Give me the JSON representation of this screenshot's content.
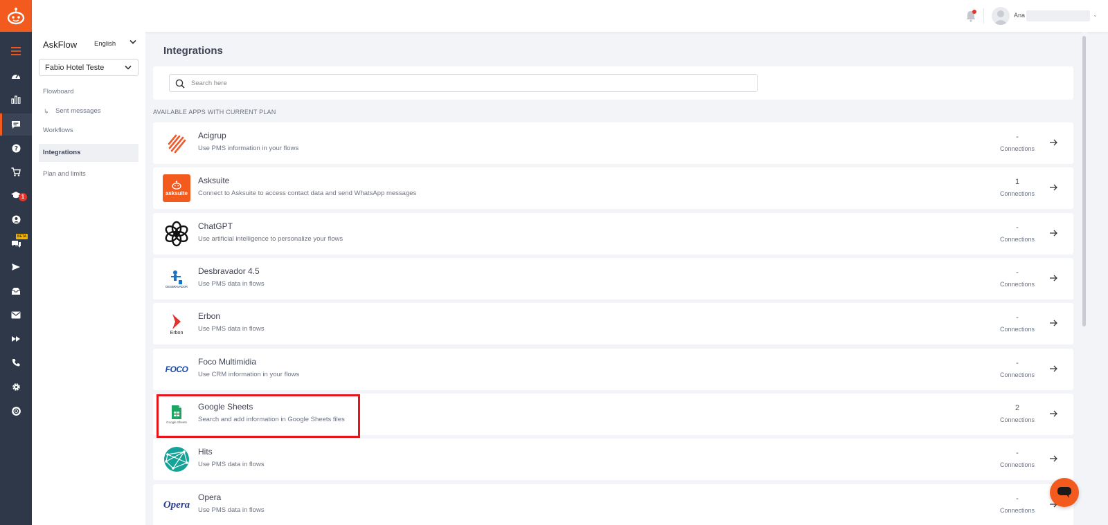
{
  "brand": {
    "accent": "#f35a1e",
    "rail_bg": "#2f3849",
    "highlight": "#e8141c"
  },
  "rail": {
    "items": [
      {
        "icon": "menu-icon"
      },
      {
        "icon": "dashboard-icon"
      },
      {
        "icon": "bar-chart-icon"
      },
      {
        "icon": "chat-flow-icon",
        "active": true
      },
      {
        "icon": "help-icon"
      },
      {
        "icon": "cart-icon"
      },
      {
        "icon": "graduation-cap-icon",
        "badge": "1"
      },
      {
        "icon": "user-circle-icon"
      },
      {
        "icon": "chat-bubbles-icon",
        "badge_beta": "BETA"
      },
      {
        "icon": "send-icon"
      },
      {
        "icon": "inbox-icon"
      },
      {
        "icon": "mail-icon"
      },
      {
        "icon": "fast-forward-icon"
      },
      {
        "icon": "phone-icon"
      },
      {
        "icon": "gear-icon"
      },
      {
        "icon": "lifebuoy-icon"
      }
    ]
  },
  "topbar": {
    "user_name": "Ana"
  },
  "sidebar": {
    "title": "AskFlow",
    "language": "English",
    "hotel": "Fabio Hotel Teste",
    "links": {
      "flowboard": "Flowboard",
      "sent_messages": "Sent messages",
      "workflows": "Workflows",
      "integrations": "Integrations",
      "plan": "Plan and limits"
    }
  },
  "main": {
    "title": "Integrations",
    "search_placeholder": "Search here",
    "section_label": "AVAILABLE APPS WITH CURRENT PLAN",
    "connections_label": "Connections",
    "apps": [
      {
        "name": "Acigrup",
        "description": "Use PMS information in your flows",
        "count": "-",
        "logo": "acigrup-logo"
      },
      {
        "name": "Asksuite",
        "description": "Connect to Asksuite to access contact data and send WhatsApp messages",
        "count": "1",
        "logo": "asksuite-logo",
        "logo_text": "asksuite"
      },
      {
        "name": "ChatGPT",
        "description": "Use artificial intelligence to personalize your flows",
        "count": "-",
        "logo": "chatgpt-logo"
      },
      {
        "name": "Desbravador 4.5",
        "description": "Use PMS data in flows",
        "count": "-",
        "logo": "desbravador-logo",
        "logo_text": "DESBRAVADOR"
      },
      {
        "name": "Erbon",
        "description": "Use PMS data in flows",
        "count": "-",
        "logo": "erbon-logo",
        "logo_text": "Erbon"
      },
      {
        "name": "Foco Multimidia",
        "description": "Use CRM information in your flows",
        "count": "-",
        "logo": "foco-logo",
        "logo_text": "FOCO"
      },
      {
        "name": "Google Sheets",
        "description": "Search and add information in Google Sheets files",
        "count": "2",
        "logo": "google-sheets-logo",
        "logo_text": "Google Sheets"
      },
      {
        "name": "Hits",
        "description": "Use PMS data in flows",
        "count": "-",
        "logo": "hits-logo"
      },
      {
        "name": "Opera",
        "description": "Use PMS data in flows",
        "count": "-",
        "logo": "opera-logo",
        "logo_text": "Opera"
      }
    ]
  }
}
